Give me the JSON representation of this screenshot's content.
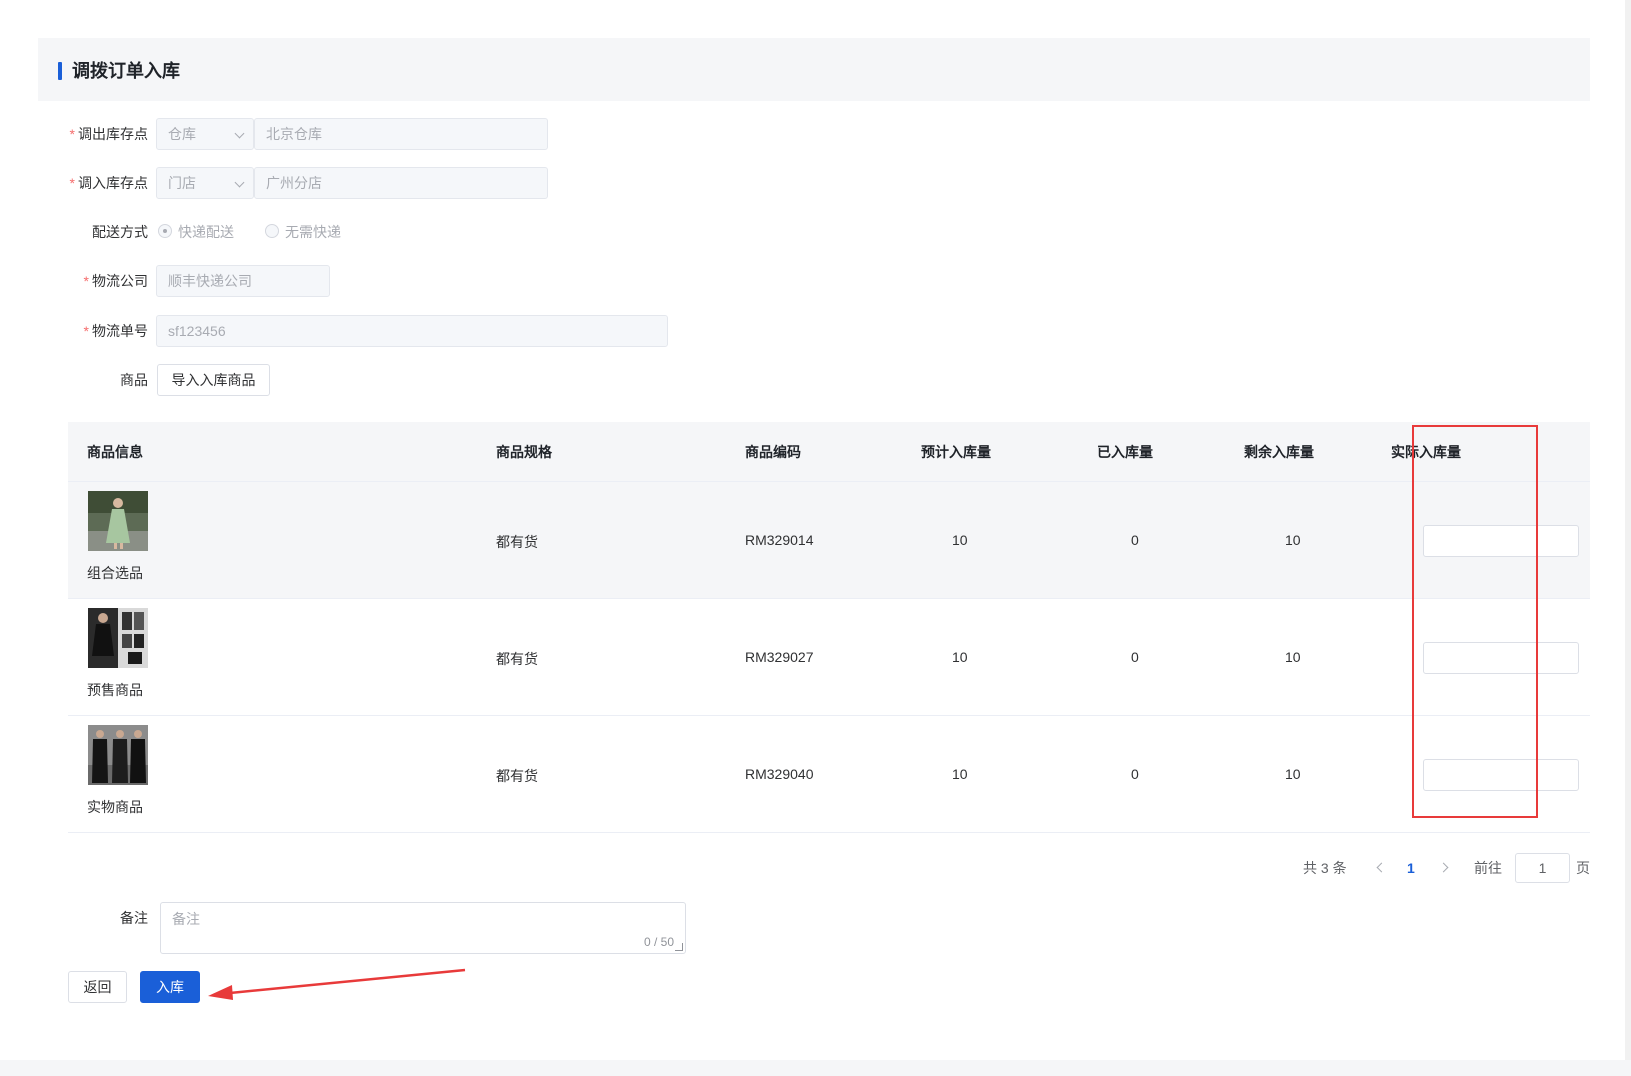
{
  "page_title": "调拨订单入库",
  "form": {
    "out_location": {
      "label": "调出库存点",
      "type_value": "仓库",
      "location_value": "北京仓库"
    },
    "in_location": {
      "label": "调入库存点",
      "type_value": "门店",
      "location_value": "广州分店"
    },
    "delivery": {
      "label": "配送方式",
      "options": [
        "快递配送",
        "无需快递"
      ],
      "selected": "快递配送"
    },
    "logistics_company": {
      "label": "物流公司",
      "value": "顺丰快递公司"
    },
    "tracking_no": {
      "label": "物流单号",
      "value": "sf123456"
    },
    "goods": {
      "label": "商品",
      "import_button": "导入入库商品"
    },
    "remark": {
      "label": "备注",
      "placeholder": "备注",
      "counter": "0 / 50"
    }
  },
  "table": {
    "headers": [
      "商品信息",
      "商品规格",
      "商品编码",
      "预计入库量",
      "已入库量",
      "剩余入库量",
      "实际入库量"
    ],
    "rows": [
      {
        "name": "组合选品",
        "spec": "都有货",
        "code": "RM329014",
        "expected": "10",
        "received": "0",
        "remaining": "10",
        "actual": ""
      },
      {
        "name": "预售商品",
        "spec": "都有货",
        "code": "RM329027",
        "expected": "10",
        "received": "0",
        "remaining": "10",
        "actual": ""
      },
      {
        "name": "实物商品",
        "spec": "都有货",
        "code": "RM329040",
        "expected": "10",
        "received": "0",
        "remaining": "10",
        "actual": ""
      }
    ]
  },
  "pagination": {
    "total": "共 3 条",
    "current": "1",
    "goto_prefix": "前往",
    "goto_value": "1",
    "goto_suffix": "页"
  },
  "actions": {
    "back": "返回",
    "submit": "入库"
  },
  "colors": {
    "accent": "#1a5fd8",
    "annotation": "#e83a3a",
    "required": "#f56c6c"
  }
}
